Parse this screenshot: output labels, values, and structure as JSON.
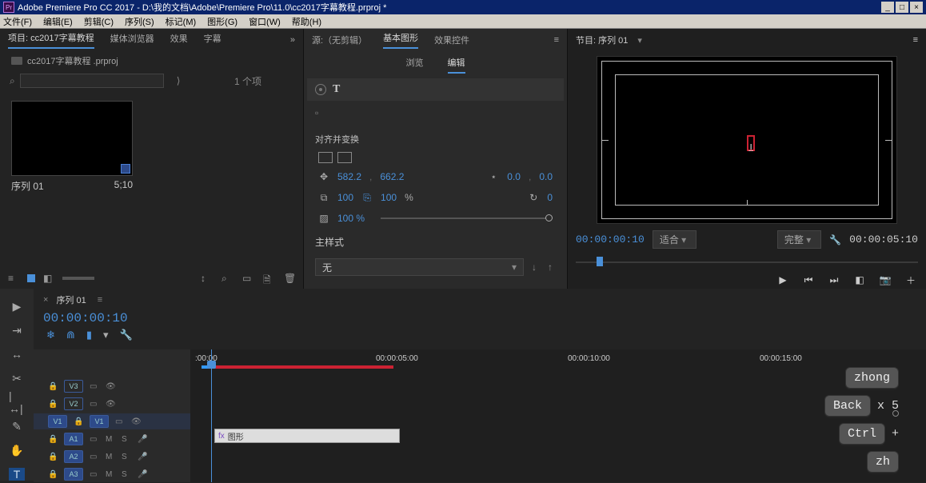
{
  "title_bar": {
    "app_icon": "Pr",
    "title": "Adobe Premiere Pro CC 2017 - D:\\我的文档\\Adobe\\Premiere Pro\\11.0\\cc2017字幕教程.prproj *"
  },
  "menu": {
    "file": "文件(F)",
    "edit": "编辑(E)",
    "clip": "剪辑(C)",
    "sequence": "序列(S)",
    "marker": "标记(M)",
    "graphics": "图形(G)",
    "window": "窗口(W)",
    "help": "帮助(H)"
  },
  "project_panel": {
    "tabs": {
      "project": "项目: cc2017字幕教程",
      "media": "媒体浏览器",
      "effects": "效果",
      "captions": "字幕"
    },
    "file_name": "cc2017字幕教程 .prproj",
    "search_placeholder": "",
    "item_count": "1 个项",
    "thumb_name": "序列 01",
    "thumb_dur": "5;10"
  },
  "center_panel": {
    "tabs": {
      "source": "源:（无剪辑）",
      "graphics": "基本图形",
      "effect_controls": "效果控件"
    },
    "sub_tabs": {
      "browse": "浏览",
      "edit": "编辑"
    },
    "layer_type": "T",
    "section_align": "对齐并变换",
    "pos_x": "582.2",
    "pos_y": "662.2",
    "anchor_x": "0.0",
    "anchor_y": "0.0",
    "scale_w": "100",
    "scale_h": "100",
    "scale_unit": "%",
    "rotation": "0",
    "opacity": "100 %",
    "style_label": "主样式",
    "style_value": "无"
  },
  "program_panel": {
    "title": "节目: 序列 01",
    "timecode": "00:00:00:10",
    "zoom": "适合",
    "quality": "完整",
    "duration": "00:00:05:10"
  },
  "timeline": {
    "tab": "序列 01",
    "timecode": "00:00:00:10",
    "ruler": {
      "t0": ":00:00",
      "t1": "00:00:05:00",
      "t2": "00:00:10:00",
      "t3": "00:00:15:00"
    },
    "tracks": {
      "v3": "V3",
      "v2": "V2",
      "v1": "V1",
      "a1": "A1",
      "a2": "A2",
      "a3": "A3"
    },
    "clip_label": "图形",
    "track_sel": "V1"
  },
  "key_overlay": {
    "l1": "zhong",
    "l2a": "Back",
    "l2b": "x 5",
    "l3a": "Ctrl",
    "l3b": "+",
    "l4": "zh"
  }
}
